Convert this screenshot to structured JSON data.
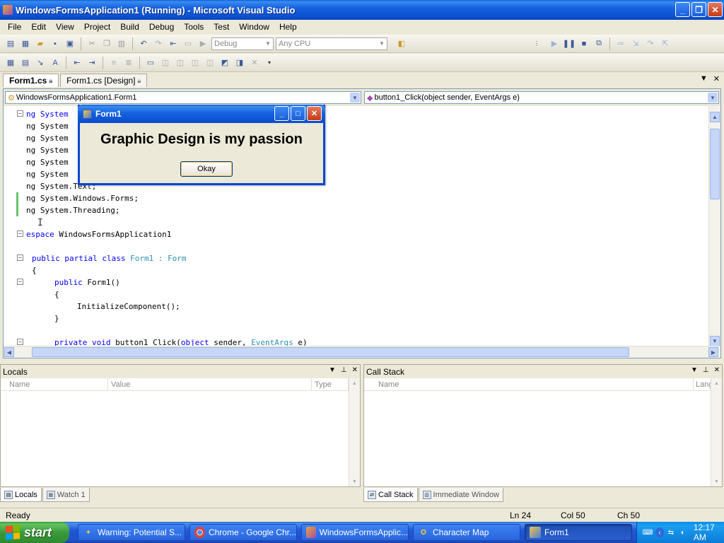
{
  "window": {
    "title": "WindowsFormsApplication1 (Running) - Microsoft Visual Studio"
  },
  "menu": [
    "File",
    "Edit",
    "View",
    "Project",
    "Build",
    "Debug",
    "Tools",
    "Test",
    "Window",
    "Help"
  ],
  "toolbar": {
    "config": "Debug",
    "platform": "Any CPU"
  },
  "doc_tabs": {
    "active": "Form1.cs",
    "inactive": "Form1.cs [Design]"
  },
  "nav": {
    "class": "WindowsFormsApplication1.Form1",
    "member": "button1_Click(object sender, EventArgs e)"
  },
  "code": {
    "l1": "ng System",
    "l2": "ng System",
    "l3": "ng System",
    "l4": "ng System",
    "l5": "ng System",
    "l6": "ng System",
    "l7": "ng System.Text;",
    "l8": "ng System.Windows.Forms;",
    "l9": "ng System.Threading;",
    "l11_kw": "espace",
    "l11_rest": " WindowsFormsApplication1",
    "l13_kw": "public partial class",
    "l13_name": " Form1 : ",
    "l13_type": "Form",
    "l14": "{",
    "l15_kw": "public",
    "l15_rest": " Form1()",
    "l16": "{",
    "l17": "InitializeComponent();",
    "l18": "}",
    "l20_kw1": "private void",
    "l20_mid": " button1 Click(",
    "l20_kw2": "object",
    "l20_mid2": " sender, ",
    "l20_type": "EventArgs",
    "l20_end": " e)"
  },
  "dialog": {
    "title": "Form1",
    "message": "Graphic Design is my passion",
    "button": "Okay"
  },
  "locals": {
    "title": "Locals",
    "columns": [
      "Name",
      "Value",
      "Type"
    ]
  },
  "callstack": {
    "title": "Call Stack",
    "columns": [
      "Name",
      "Langu"
    ]
  },
  "panel_tabs_left": [
    "Locals",
    "Watch 1"
  ],
  "panel_tabs_right": [
    "Call Stack",
    "Immediate Window"
  ],
  "status": {
    "ready": "Ready",
    "ln": "Ln 24",
    "col": "Col 50",
    "ch": "Ch 50"
  },
  "taskbar": {
    "start": "start",
    "tasks": [
      "Warning: Potential S...",
      "Chrome - Google Chr...",
      "WindowsFormsApplic...",
      "Character Map",
      "Form1"
    ],
    "clock": "12:17 AM"
  }
}
